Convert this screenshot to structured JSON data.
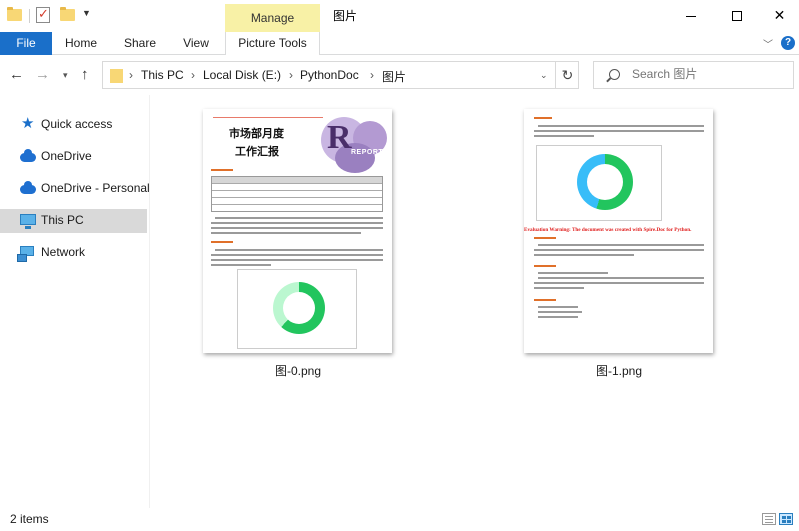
{
  "window": {
    "title": "图片",
    "contextual_tab_group": "Manage"
  },
  "ribbon": {
    "tabs": [
      {
        "label": "File"
      },
      {
        "label": "Home"
      },
      {
        "label": "Share"
      },
      {
        "label": "View"
      },
      {
        "label": "Picture Tools"
      }
    ]
  },
  "address": {
    "segments": [
      "This PC",
      "Local Disk (E:)",
      "PythonDoc",
      "图片"
    ]
  },
  "search": {
    "placeholder": "Search 图片"
  },
  "navigation": {
    "items": [
      {
        "label": "Quick access",
        "icon": "star-icon"
      },
      {
        "label": "OneDrive",
        "icon": "cloud-icon"
      },
      {
        "label": "OneDrive - Personal",
        "icon": "cloud-icon"
      },
      {
        "label": "This PC",
        "icon": "computer-icon",
        "selected": true
      },
      {
        "label": "Network",
        "icon": "network-icon"
      }
    ]
  },
  "files": [
    {
      "name": "图-0.png",
      "preview": {
        "title_line1": "市场部月度",
        "title_line2": "工作汇报",
        "banner": "REPORT"
      }
    },
    {
      "name": "图-1.png",
      "preview": {
        "warning": "Evaluation Warning: The document was created with Spire.Doc for Python."
      }
    }
  ],
  "status": {
    "item_count": "2 items"
  },
  "colors": {
    "file_tab": "#1a6fc9",
    "manage_tab": "#f8f1a6",
    "selection": "#d9d9d9",
    "donut_green": "#22c55e",
    "donut_teal": "#38bdf8"
  }
}
